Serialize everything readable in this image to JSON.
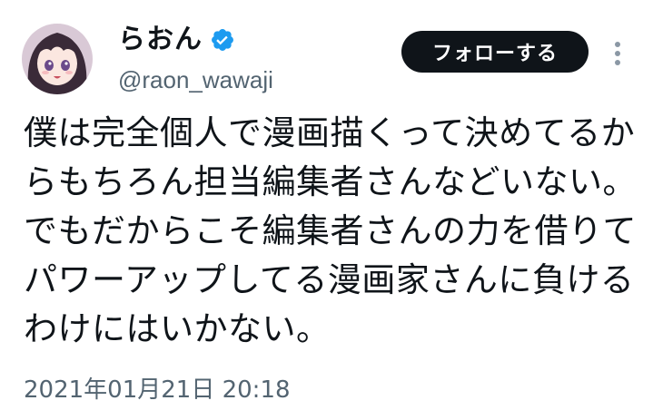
{
  "user": {
    "display_name": "らおん",
    "handle": "@raon_wawaji",
    "verified": true,
    "avatar_icon": "anime-girl-avatar"
  },
  "follow_button": {
    "label": "フォローする"
  },
  "more_menu": {
    "icon": "vertical-ellipsis-icon"
  },
  "tweet": {
    "lines": [
      "僕は完全個人で漫画描くって決めてるか",
      "らもちろん担当編集者さんなどいない。",
      "でもだからこそ編集者さんの力を借りて",
      "パワーアップしてる漫画家さんに負ける",
      "わけにはいかない。"
    ],
    "timestamp": "2021年01月21日 20:18"
  },
  "colors": {
    "text_primary": "#0f1419",
    "text_secondary": "#536471",
    "verified_blue": "#1d9bf0",
    "button_bg": "#0f1419",
    "button_text": "#ffffff"
  }
}
